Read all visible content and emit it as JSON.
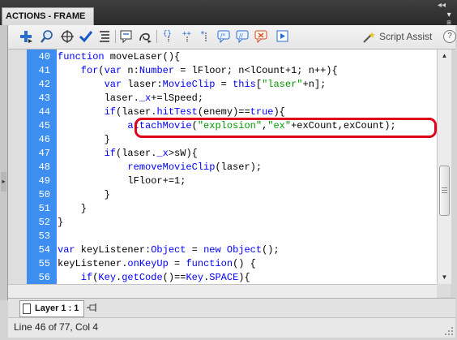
{
  "panel": {
    "title": "ACTIONS - FRAME"
  },
  "toolbar": {
    "buttons": [
      {
        "icon": "add-statement-icon"
      },
      {
        "icon": "find-icon"
      },
      {
        "icon": "insert-target-path-icon"
      },
      {
        "icon": "check-syntax-icon"
      },
      {
        "icon": "auto-format-icon"
      },
      {
        "icon": "show-code-hint-icon"
      },
      {
        "icon": "debug-options-icon"
      },
      {
        "icon": "collapse-between-braces-icon"
      },
      {
        "icon": "collapse-selection-icon"
      },
      {
        "icon": "expand-all-icon"
      },
      {
        "icon": "apply-block-comment-icon"
      },
      {
        "icon": "apply-line-comment-icon"
      },
      {
        "icon": "remove-comment-icon"
      },
      {
        "icon": "show-hide-toolbox-icon"
      }
    ],
    "script_assist_label": "Script Assist",
    "help_label": "?"
  },
  "code": {
    "lines": [
      {
        "num": "40",
        "segments": [
          {
            "t": "function",
            "c": "kw"
          },
          {
            "t": " moveLaser(){",
            "c": ""
          }
        ]
      },
      {
        "num": "41",
        "segments": [
          {
            "t": "    for",
            "c": "kw"
          },
          {
            "t": "(",
            "c": ""
          },
          {
            "t": "var",
            "c": "kw"
          },
          {
            "t": " n:",
            "c": ""
          },
          {
            "t": "Number",
            "c": "tp"
          },
          {
            "t": " = lFloor; n<lCount+1; n++){",
            "c": ""
          }
        ]
      },
      {
        "num": "42",
        "segments": [
          {
            "t": "        var",
            "c": "kw"
          },
          {
            "t": " laser:",
            "c": ""
          },
          {
            "t": "MovieClip",
            "c": "tp"
          },
          {
            "t": " = ",
            "c": ""
          },
          {
            "t": "this",
            "c": "kw"
          },
          {
            "t": "[",
            "c": ""
          },
          {
            "t": "\"laser\"",
            "c": "str"
          },
          {
            "t": "+n];",
            "c": ""
          }
        ]
      },
      {
        "num": "43",
        "segments": [
          {
            "t": "        laser.",
            "c": ""
          },
          {
            "t": "_x",
            "c": "kw"
          },
          {
            "t": "+=lSpeed;",
            "c": ""
          }
        ]
      },
      {
        "num": "44",
        "segments": [
          {
            "t": "        if",
            "c": "kw"
          },
          {
            "t": "(laser.",
            "c": ""
          },
          {
            "t": "hitTest",
            "c": "fn"
          },
          {
            "t": "(enemy)==",
            "c": ""
          },
          {
            "t": "true",
            "c": "kw"
          },
          {
            "t": "){",
            "c": ""
          }
        ]
      },
      {
        "num": "45",
        "segments": [
          {
            "t": "            ",
            "c": ""
          },
          {
            "t": "attachMovie",
            "c": "fn"
          },
          {
            "t": "(",
            "c": ""
          },
          {
            "t": "\"explosion\"",
            "c": "str"
          },
          {
            "t": ",",
            "c": ""
          },
          {
            "t": "\"ex\"",
            "c": "str"
          },
          {
            "t": "+exCount,exCount);",
            "c": ""
          }
        ]
      },
      {
        "num": "46",
        "segments": [
          {
            "t": "        }",
            "c": ""
          }
        ]
      },
      {
        "num": "47",
        "segments": [
          {
            "t": "        if",
            "c": "kw"
          },
          {
            "t": "(laser.",
            "c": ""
          },
          {
            "t": "_x",
            "c": "kw"
          },
          {
            "t": ">sW){",
            "c": ""
          }
        ]
      },
      {
        "num": "48",
        "segments": [
          {
            "t": "            ",
            "c": ""
          },
          {
            "t": "removeMovieClip",
            "c": "fn"
          },
          {
            "t": "(laser);",
            "c": ""
          }
        ]
      },
      {
        "num": "49",
        "segments": [
          {
            "t": "            lFloor+=1;",
            "c": ""
          }
        ]
      },
      {
        "num": "50",
        "segments": [
          {
            "t": "        }",
            "c": ""
          }
        ]
      },
      {
        "num": "51",
        "segments": [
          {
            "t": "    }",
            "c": ""
          }
        ]
      },
      {
        "num": "52",
        "segments": [
          {
            "t": "}",
            "c": ""
          }
        ]
      },
      {
        "num": "53",
        "segments": [
          {
            "t": "",
            "c": ""
          }
        ]
      },
      {
        "num": "54",
        "segments": [
          {
            "t": "var",
            "c": "kw"
          },
          {
            "t": " keyListener:",
            "c": ""
          },
          {
            "t": "Object",
            "c": "tp"
          },
          {
            "t": " = ",
            "c": ""
          },
          {
            "t": "new",
            "c": "kw"
          },
          {
            "t": " ",
            "c": ""
          },
          {
            "t": "Object",
            "c": "tp"
          },
          {
            "t": "();",
            "c": ""
          }
        ]
      },
      {
        "num": "55",
        "segments": [
          {
            "t": "keyListener.",
            "c": ""
          },
          {
            "t": "onKeyUp",
            "c": "fn"
          },
          {
            "t": " = ",
            "c": ""
          },
          {
            "t": "function",
            "c": "kw"
          },
          {
            "t": "() {",
            "c": ""
          }
        ]
      },
      {
        "num": "56",
        "segments": [
          {
            "t": "    if",
            "c": "kw"
          },
          {
            "t": "(",
            "c": ""
          },
          {
            "t": "Key",
            "c": "tp"
          },
          {
            "t": ".",
            "c": ""
          },
          {
            "t": "getCode",
            "c": "fn"
          },
          {
            "t": "()==",
            "c": ""
          },
          {
            "t": "Key",
            "c": "tp"
          },
          {
            "t": ".",
            "c": ""
          },
          {
            "t": "SPACE",
            "c": "kw"
          },
          {
            "t": "){",
            "c": ""
          }
        ]
      }
    ],
    "highlighted_line": "45",
    "highlight_color": "#e0001a"
  },
  "layer_tab": {
    "label": "Layer 1 : 1"
  },
  "status": {
    "text": "Line 46 of 77, Col 4"
  },
  "colors": {
    "gutter": "#3d8ef0",
    "keyword": "#0000ff",
    "string": "#009900"
  }
}
